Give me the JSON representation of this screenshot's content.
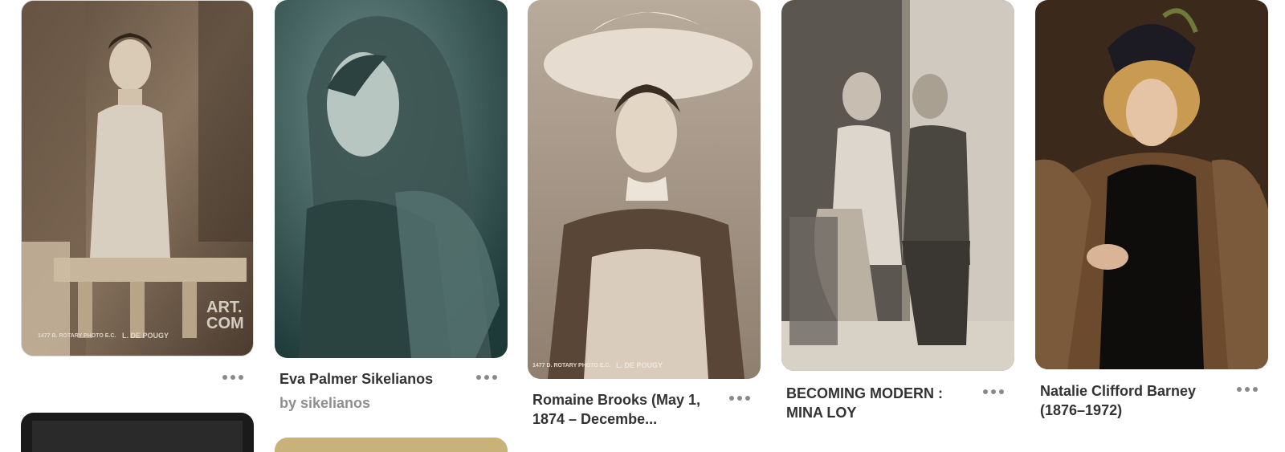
{
  "pins": [
    {
      "id": "liane-de-pougy",
      "title": "",
      "subtitle": "",
      "image_desc_icon": "vintage-postcard-photo",
      "stamp": "ART.\nCOM",
      "caption_left": "1477 B. ROTARY PHOTO E.C.",
      "caption_right": "L. DE POUGY",
      "more_label": "More options"
    },
    {
      "id": "eva-palmer",
      "title": "Eva Palmer Sikelianos",
      "subtitle": "by sikelianos",
      "more_label": "More options"
    },
    {
      "id": "romaine-brooks",
      "title": "Romaine Brooks (May 1, 1874 – Decembe...",
      "subtitle": "",
      "caption_left": "1477 D. ROTARY PHOTO E.C.",
      "caption_right": "L. DE POUGY",
      "more_label": "More options"
    },
    {
      "id": "mina-loy",
      "title": "BECOMING MODERN : MINA LOY",
      "subtitle": "",
      "more_label": "More options"
    },
    {
      "id": "natalie-barney",
      "title": "Natalie Clifford Barney (1876–1972)",
      "subtitle": "",
      "more_label": "More options"
    }
  ],
  "colors": {
    "title": "#333333",
    "subtitle": "#8e8e8e",
    "more_dots": "#8a8a8a",
    "sepia": "#8a7560",
    "teal": "#2f4f4c"
  }
}
